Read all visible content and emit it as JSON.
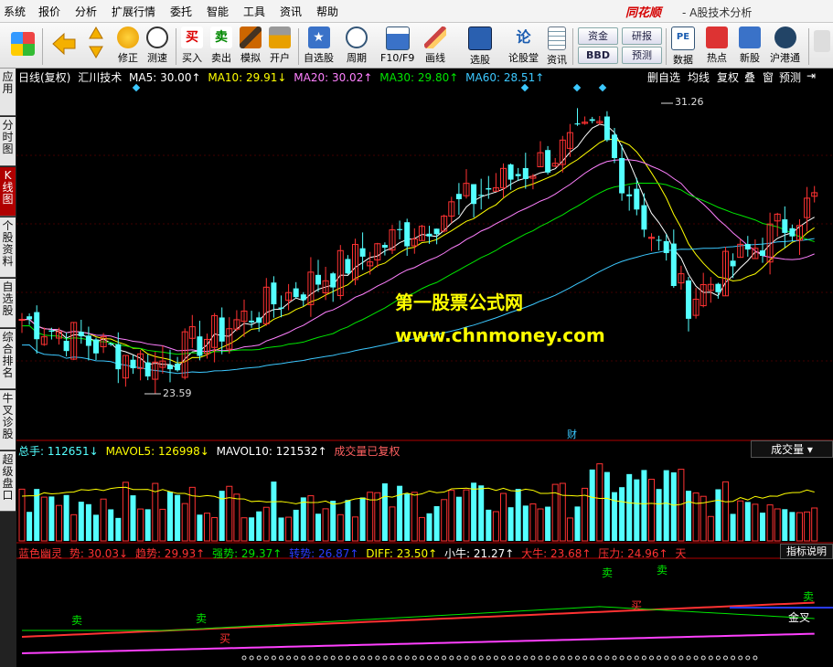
{
  "menu": [
    "系统",
    "报价",
    "分析",
    "扩展行情",
    "委托",
    "智能",
    "工具",
    "资讯",
    "帮助"
  ],
  "brand": "同花顺",
  "window_title": "- A股技术分析",
  "toolbar": {
    "buttons": [
      {
        "label": "修正",
        "icon": "refresh-icon"
      },
      {
        "label": "测速",
        "icon": "clock-icon"
      },
      {
        "label": "买入",
        "icon": "buy-icon",
        "glyph": "买"
      },
      {
        "label": "卖出",
        "icon": "sell-icon",
        "glyph": "卖"
      },
      {
        "label": "模拟",
        "icon": "gavel-icon"
      },
      {
        "label": "开户",
        "icon": "lock-icon"
      },
      {
        "label": "自选股",
        "icon": "star-icon"
      },
      {
        "label": "周期",
        "icon": "cycle-icon"
      },
      {
        "label": "F10/F9",
        "icon": "f10-icon"
      },
      {
        "label": "画线",
        "icon": "pen-icon"
      },
      {
        "label": "选股",
        "icon": "select-icon"
      },
      {
        "label": "论股堂",
        "icon": "forum-icon",
        "glyph": "论"
      },
      {
        "label": "资讯",
        "icon": "doc-icon"
      },
      {
        "label": "数据",
        "icon": "pe-icon",
        "glyph": "PE"
      },
      {
        "label": "热点",
        "icon": "hot-icon"
      },
      {
        "label": "新股",
        "icon": "ipo-icon"
      },
      {
        "label": "沪港通",
        "icon": "hk-icon"
      }
    ],
    "pills": [
      "资金",
      "研报",
      "BBD",
      "预测"
    ]
  },
  "sidebar": [
    {
      "label": "应用",
      "active": false
    },
    {
      "label": "分时图",
      "active": false
    },
    {
      "label": "K线图",
      "active": true
    },
    {
      "label": "个股资料",
      "active": false
    },
    {
      "label": "自选股",
      "active": false
    },
    {
      "label": "综合排名",
      "active": false
    },
    {
      "label": "牛叉诊股",
      "active": false
    },
    {
      "label": "超级盘口",
      "active": false
    }
  ],
  "kline_header": {
    "title": "日线(复权)",
    "indicator": "汇川技术",
    "ma5": "MA5: 30.00↑",
    "ma10": "MA10: 29.91↓",
    "ma20": "MA20: 30.02↑",
    "ma30": "MA30: 29.80↑",
    "ma60": "MA60: 28.51↑"
  },
  "kline_buttons": [
    "删自选",
    "均线",
    "复权",
    "叠",
    "窗",
    "预测"
  ],
  "price_labels": {
    "high": "31.26",
    "low": "23.59"
  },
  "finance_marker": "财",
  "volume_header": {
    "total": "总手: 112651↓",
    "mavol5": "MAVOL5: 126998↓",
    "mavol10": "MAVOL10: 121532↑",
    "note": "成交量已复权"
  },
  "volume_dropdown": "成交量",
  "indicator_header": {
    "name": "蓝色幽灵",
    "shi": "势: 30.03↓",
    "qushi": "趋势: 29.93↑",
    "qiangshi": "强势: 29.37↑",
    "zhuanshi": "转势: 26.87↑",
    "diff": "DIFF: 23.50↑",
    "xiaoniu": "小牛: 21.27↑",
    "daniu": "大牛: 23.68↑",
    "yali": "压力: 24.96↑",
    "tian": "天"
  },
  "indicator_button": "指标说明",
  "indicator_marks": {
    "sell": "卖",
    "buy": "买",
    "golden_cross": "金叉"
  },
  "watermark": {
    "line1": "第一股票公式网",
    "line2": "www.chnmoney.com"
  },
  "colors": {
    "up": "#ff3232",
    "down": "#54ffff",
    "ma5": "#ffffff",
    "ma10": "#ffff00",
    "ma20": "#ff80ff",
    "ma30": "#00e600",
    "ma60": "#3cc8ff"
  }
}
